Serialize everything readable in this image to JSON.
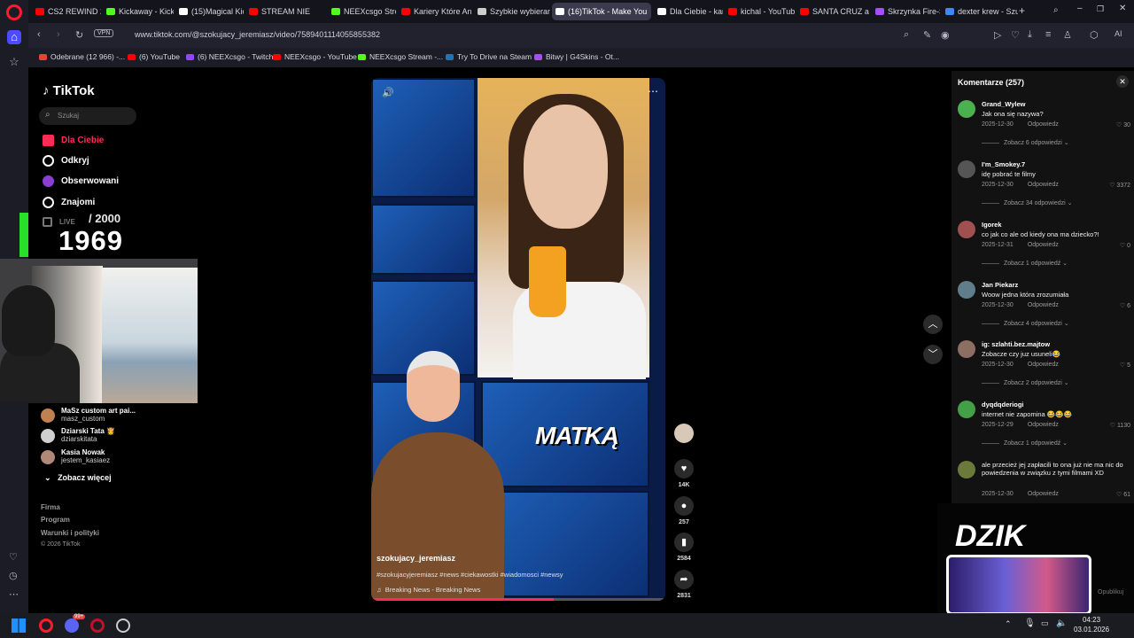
{
  "browser": {
    "tabs": [
      {
        "label": "CS2 REWIND 202",
        "color": "#ff0000"
      },
      {
        "label": "Kickaway - Kick C",
        "color": "#53fc18"
      },
      {
        "label": "(15)Magical Kick",
        "color": "#ffffff"
      },
      {
        "label": "STREAM NIE",
        "color": "#ff0000"
      },
      {
        "label": "NEEXcsgo Stream",
        "color": "#53fc18"
      },
      {
        "label": "Kariery Które An",
        "color": "#ff0000"
      },
      {
        "label": "Szybkie wybieran",
        "color": "#cccccc"
      },
      {
        "label": "(16)TikTok - Make You",
        "color": "#ffffff",
        "active": true
      },
      {
        "label": "Dla Ciebie - kana",
        "color": "#ffffff"
      },
      {
        "label": "kichal - YouTube",
        "color": "#ff0000"
      },
      {
        "label": "SANTA CRUZ ale",
        "color": "#ff0000"
      },
      {
        "label": "Skrzynka Fire-Se",
        "color": "#a64dff"
      },
      {
        "label": "dexter krew - Szu",
        "color": "#4285f4"
      }
    ],
    "vpn_label": "VPN",
    "url": "www.tiktok.com/@szokujacy_jeremiasz/video/7589401114055855382",
    "bookmarks": [
      {
        "label": "Odebrane (12 966) -...",
        "color": "#ea4335"
      },
      {
        "label": "(6) YouTube",
        "color": "#ff0000"
      },
      {
        "label": "(6) NEEXcsgo - Twitch",
        "color": "#9146ff"
      },
      {
        "label": "NEEXcsgo - YouTube",
        "color": "#ff0000"
      },
      {
        "label": "NEEXcsgo Stream -...",
        "color": "#53fc18"
      },
      {
        "label": "Try To Drive na Steam",
        "color": "#1b75bb"
      },
      {
        "label": "Bitwy | G4Skins - Ot...",
        "color": "#a64dff"
      }
    ],
    "ai_label": "AI"
  },
  "tiktok": {
    "logo": "TikTok",
    "search_placeholder": "Szukaj",
    "nav": {
      "for_you": "Dla Ciebie",
      "explore": "Odkryj",
      "following": "Obserwowani",
      "friends": "Znajomi",
      "live": "LIVE"
    },
    "suggested": [
      {
        "name": "MaSz custom art pai...",
        "user": "masz_custom"
      },
      {
        "name": "Dziarski Tata 👸",
        "user": "dziarskitata"
      },
      {
        "name": "Kasia Nowak",
        "user": "jestem_kasiaez"
      }
    ],
    "see_more": "Zobacz więcej",
    "footer": {
      "company": "Firma",
      "program": "Program",
      "terms": "Warunki i polityki",
      "copyright": "© 2026 TikTok"
    }
  },
  "overlay": {
    "counter_value": "1969",
    "counter_max": "/ 2000"
  },
  "video": {
    "overlay_text": "MATKĄ",
    "author": "szokujacy_jeremiasz",
    "hashtags": "#szokujacyjeremiasz #news #ciekawostki #wiadomosci #newsy",
    "music": "Breaking News - Breaking News",
    "progress": 0.62,
    "likes": "14K",
    "comments": "257",
    "saves": "2584",
    "shares": "2831"
  },
  "comments_panel": {
    "title": "Komentarze (257)",
    "items": [
      {
        "name": "Grand_Wylew",
        "text": "Jak ona się nazywa?",
        "date": "2025-12-30",
        "reply": "Odpowiedz",
        "likes": "30",
        "view": "Zobacz 6 odpowiedzi",
        "avatar_color": "#4caf50"
      },
      {
        "name": "I'm_Smokey.7",
        "text": "idę pobrać te filmy",
        "date": "2025-12-30",
        "reply": "Odpowiedz",
        "likes": "3372",
        "view": "Zobacz 34 odpowiedzi",
        "avatar_color": "#555555"
      },
      {
        "name": "Igorek",
        "text": "co jak co ale od kiedy ona ma dziecko?!",
        "date": "2025-12-31",
        "reply": "Odpowiedz",
        "likes": "0",
        "view": "Zobacz 1 odpowiedź",
        "avatar_color": "#a05050"
      },
      {
        "name": "Jan Piekarz",
        "text": "Woow jedna która zrozumiała",
        "date": "2025-12-30",
        "reply": "Odpowiedz",
        "likes": "6",
        "view": "Zobacz 4 odpowiedzi",
        "avatar_color": "#607d8b"
      },
      {
        "name": "ig: szlahti.bez.majtow",
        "text": "Zobacze czy juz usuneli😂",
        "date": "2025-12-30",
        "reply": "Odpowiedz",
        "likes": "5",
        "view": "Zobacz 2 odpowiedzi",
        "avatar_color": "#8d6e63"
      },
      {
        "name": "dyqdqderiogi",
        "text": "internet nie zapomina 😂😂😂",
        "date": "2025-12-29",
        "reply": "Odpowiedz",
        "likes": "1130",
        "view": "Zobacz 1 odpowiedź",
        "avatar_color": "#43a047"
      },
      {
        "name": "",
        "text": "ale przecież jej zapłacili to ona już nie ma nic do powiedzenia w związku z tymi filmami XD",
        "date": "2025-12-30",
        "reply": "Odpowiedz",
        "likes": "61",
        "view": "",
        "avatar_color": "#6b7a3a"
      }
    ],
    "publish": "Opublikuj"
  },
  "stream_overlay": {
    "brand": "DZIK"
  },
  "taskbar": {
    "time": "04:23",
    "date": "03.01.2026",
    "badge": "99+"
  }
}
